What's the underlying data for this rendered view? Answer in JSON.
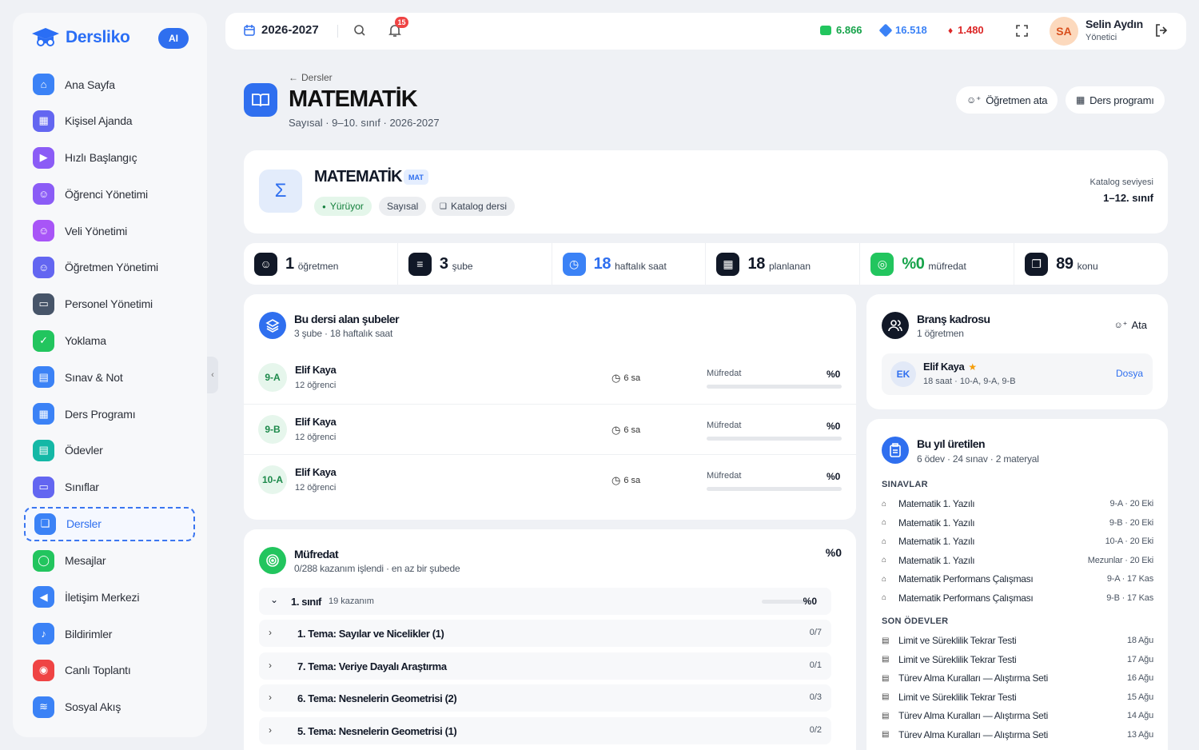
{
  "sidebar": {
    "brand": "Dersliko",
    "ai_badge": "AI",
    "items": [
      {
        "label": "Ana Sayfa",
        "color": "#3b82f6",
        "icon": "home-icon",
        "glyph": "⌂"
      },
      {
        "label": "Kişisel Ajanda",
        "color": "#6366f1",
        "icon": "calendar-icon",
        "glyph": "▦"
      },
      {
        "label": "Hızlı Başlangıç",
        "color": "#8b5cf6",
        "icon": "play-icon",
        "glyph": "▶"
      },
      {
        "label": "Öğrenci Yönetimi",
        "color": "#8b5cf6",
        "icon": "users-icon",
        "glyph": "☺"
      },
      {
        "label": "Veli Yönetimi",
        "color": "#a855f7",
        "icon": "users-icon",
        "glyph": "☺"
      },
      {
        "label": "Öğretmen Yönetimi",
        "color": "#6366f1",
        "icon": "teacher-icon",
        "glyph": "☺"
      },
      {
        "label": "Personel Yönetimi",
        "color": "#475569",
        "icon": "id-card-icon",
        "glyph": "▭"
      },
      {
        "label": "Yoklama",
        "color": "#22c55e",
        "icon": "checklist-icon",
        "glyph": "✓"
      },
      {
        "label": "Sınav & Not",
        "color": "#3b82f6",
        "icon": "exam-icon",
        "glyph": "▤"
      },
      {
        "label": "Ders Programı",
        "color": "#3b82f6",
        "icon": "schedule-icon",
        "glyph": "▦"
      },
      {
        "label": "Ödevler",
        "color": "#14b8a6",
        "icon": "clipboard-icon",
        "glyph": "▤"
      },
      {
        "label": "Sınıflar",
        "color": "#6366f1",
        "icon": "presentation-icon",
        "glyph": "▭"
      },
      {
        "label": "Dersler",
        "color": "#3b82f6",
        "icon": "book-icon",
        "glyph": "❑"
      },
      {
        "label": "Mesajlar",
        "color": "#22c55e",
        "icon": "chat-icon",
        "glyph": "◯"
      },
      {
        "label": "İletişim Merkezi",
        "color": "#3b82f6",
        "icon": "megaphone-icon",
        "glyph": "◀"
      },
      {
        "label": "Bildirimler",
        "color": "#3b82f6",
        "icon": "bell-icon",
        "glyph": "♪"
      },
      {
        "label": "Canlı Toplantı",
        "color": "#ef4444",
        "icon": "broadcast-icon",
        "glyph": "◉"
      },
      {
        "label": "Sosyal Akış",
        "color": "#3b82f6",
        "icon": "rss-icon",
        "glyph": "≋"
      }
    ],
    "active_index": 12
  },
  "topbar": {
    "year": "2026-2027",
    "notif_count": "15",
    "stats": [
      {
        "value": "6.866",
        "color": "#16a34a",
        "icon": "money-icon"
      },
      {
        "value": "16.518",
        "color": "#3b82f6",
        "icon": "diamond-icon"
      },
      {
        "value": "1.480",
        "color": "#dc2626",
        "icon": "fire-icon"
      }
    ],
    "user": {
      "initials": "SA",
      "name": "Selin Aydın",
      "role": "Yönetici"
    }
  },
  "page": {
    "back": "Dersler",
    "title": "MATEMATİK",
    "subtitle": "Sayısal · 9–10. sınıf · 2026-2027",
    "buttons": {
      "assign": "Öğretmen ata",
      "schedule": "Ders programı"
    }
  },
  "hero": {
    "icon_glyph": "Σ",
    "title": "MATEMATİK",
    "code": "MAT",
    "chips": {
      "status": "Yürüyor",
      "track": "Sayısal",
      "catalog": "Katalog dersi"
    },
    "catalog_label": "Katalog seviyesi",
    "catalog_value": "1–12. sınıf"
  },
  "stats": [
    {
      "num": "1",
      "label": "öğretmen",
      "color": "#111827",
      "num_color": "#111827",
      "icon": "users-icon",
      "glyph": "☺"
    },
    {
      "num": "3",
      "label": "şube",
      "color": "#111827",
      "num_color": "#111827",
      "icon": "layers-icon",
      "glyph": "≡"
    },
    {
      "num": "18",
      "label": "haftalık saat",
      "color": "#3b82f6",
      "num_color": "#2f6fef",
      "icon": "clock-icon",
      "glyph": "◷"
    },
    {
      "num": "18",
      "label": "planlanan",
      "color": "#111827",
      "num_color": "#111827",
      "icon": "calendar-icon",
      "glyph": "▦"
    },
    {
      "num": "%0",
      "label": "müfredat",
      "color": "#22c55e",
      "num_color": "#16a34a",
      "icon": "target-icon",
      "glyph": "◎"
    },
    {
      "num": "89",
      "label": "konu",
      "color": "#111827",
      "num_color": "#111827",
      "icon": "copy-icon",
      "glyph": "❐"
    }
  ],
  "branches": {
    "title": "Bu dersi alan şubeler",
    "subtitle": "3 şube · 18 haftalık saat",
    "rows": [
      {
        "code": "9-A",
        "teacher": "Elif Kaya",
        "students": "12 öğrenci",
        "hours": "6 sa",
        "m_label": "Müfredat",
        "m_value": "%0",
        "progress": 0
      },
      {
        "code": "9-B",
        "teacher": "Elif Kaya",
        "students": "12 öğrenci",
        "hours": "6 sa",
        "m_label": "Müfredat",
        "m_value": "%0",
        "progress": 0
      },
      {
        "code": "10-A",
        "teacher": "Elif Kaya",
        "students": "12 öğrenci",
        "hours": "6 sa",
        "m_label": "Müfredat",
        "m_value": "%0",
        "progress": 0
      }
    ]
  },
  "curriculum": {
    "title": "Müfredat",
    "subtitle": "0/288 kazanım işlendi · en az bir şubede",
    "percent": "%0",
    "grade": {
      "label": "1. sınıf",
      "count": "19 kazanım",
      "percent": "%0",
      "progress": 0
    },
    "topics": [
      {
        "name": "1. Tema: Sayılar ve Nicelikler (1)",
        "value": "0/7"
      },
      {
        "name": "7. Tema: Veriye Dayalı Araştırma",
        "value": "0/1"
      },
      {
        "name": "6. Tema: Nesnelerin Geometrisi (2)",
        "value": "0/3"
      },
      {
        "name": "5. Tema: Nesnelerin Geometrisi (1)",
        "value": "0/2"
      }
    ]
  },
  "staff": {
    "title": "Branş kadrosu",
    "subtitle": "1 öğretmen",
    "action": "Ata",
    "teacher": {
      "initials": "EK",
      "name": "Elif Kaya",
      "meta": "18 saat · 10-A, 9-A, 9-B",
      "link": "Dosya"
    }
  },
  "produced": {
    "title": "Bu yıl üretilen",
    "subtitle": "6 ödev · 24 sınav · 2 materyal",
    "exams_title": "SINAVLAR",
    "exams": [
      {
        "name": "Matematik 1. Yazılı",
        "meta": "9-A · 20 Eki"
      },
      {
        "name": "Matematik 1. Yazılı",
        "meta": "9-B · 20 Eki"
      },
      {
        "name": "Matematik 1. Yazılı",
        "meta": "10-A · 20 Eki"
      },
      {
        "name": "Matematik 1. Yazılı",
        "meta": "Mezunlar · 20 Eki"
      },
      {
        "name": "Matematik Performans Çalışması",
        "meta": "9-A · 17 Kas"
      },
      {
        "name": "Matematik Performans Çalışması",
        "meta": "9-B · 17 Kas"
      }
    ],
    "hw_title": "SON ÖDEVLER",
    "homework": [
      {
        "name": "Limit ve Süreklilik Tekrar Testi",
        "meta": "18 Ağu"
      },
      {
        "name": "Limit ve Süreklilik Tekrar Testi",
        "meta": "17 Ağu"
      },
      {
        "name": "Türev Alma Kuralları — Alıştırma Seti",
        "meta": "16 Ağu"
      },
      {
        "name": "Limit ve Süreklilik Tekrar Testi",
        "meta": "15 Ağu"
      },
      {
        "name": "Türev Alma Kuralları — Alıştırma Seti",
        "meta": "14 Ağu"
      },
      {
        "name": "Türev Alma Kuralları — Alıştırma Seti",
        "meta": "13 Ağu"
      }
    ]
  }
}
